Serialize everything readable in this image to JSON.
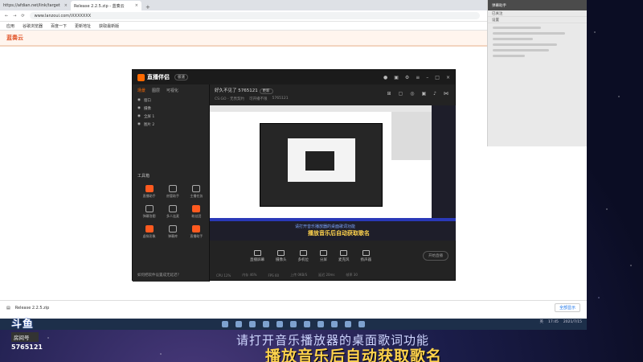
{
  "browser": {
    "tabs": [
      {
        "title": "https://afdian.net/link/target"
      },
      {
        "title": "Release 2.2.5.zip - 蓝奏云"
      }
    ],
    "new_tab": "+",
    "url": "www.lanzoui.com/iXXXXXXX",
    "bookmarks": [
      "应用",
      "谷歌浏览器",
      "百度一下",
      "更新地址",
      "获取最新版"
    ],
    "site_logo": "蓝奏云"
  },
  "side_panel": {
    "header": "弹幕助手",
    "rows": [
      "已关注",
      "设置"
    ]
  },
  "app": {
    "name": "直播伴侣",
    "version_badge": "极速",
    "source_tabs": [
      "场景",
      "图层",
      "可视化"
    ],
    "sources": [
      "窗口",
      "摄像",
      "全屏 1",
      "图片 2"
    ],
    "tools_title": "工具箱",
    "tools": [
      {
        "label": "直播助手",
        "hot": true
      },
      {
        "label": "房管助手",
        "hot": false
      },
      {
        "label": "主播任务",
        "hot": false
      },
      {
        "label": "弹幕答题",
        "hot": false
      },
      {
        "label": "多人连麦",
        "hot": false
      },
      {
        "label": "粉丝团",
        "hot": true
      },
      {
        "label": "虚拟形象",
        "hot": true
      },
      {
        "label": "弹幕库",
        "hot": false
      },
      {
        "label": "直播助手",
        "hot": true
      }
    ],
    "tip": "如何把软件设置成无延迟？",
    "room_title": "好久不见了 5765121",
    "room_tag": "更新",
    "room_meta": [
      "CS:GO - 无畏契约",
      "可开播不限",
      "5765121"
    ],
    "preview_sub1": "请打开音乐播放器的桌面歌词功能",
    "preview_sub2": "播放音乐后自动获取歌名",
    "controls": [
      "直播屏幕",
      "摄像头",
      "多机位",
      "分屏",
      "麦克风",
      "扬声器"
    ],
    "start_label": "开始直播",
    "status": [
      "CPU 12%",
      "内存 46%",
      "FPS 60",
      "上传 0KB/S",
      "延迟 20ms",
      "帧率 30"
    ]
  },
  "downloads": {
    "file": "Release 2.2.5.zip",
    "show_all": "全部显示"
  },
  "taskbar": {
    "clock": "17:45",
    "date": "2021/7/15",
    "ime": "英"
  },
  "overlay": {
    "platform": "斗鱼",
    "room_label": "房间号",
    "room_id": "5765121",
    "caption1": "请打开音乐播放器的桌面歌词功能",
    "caption2": "播放音乐后自动获取歌名"
  }
}
